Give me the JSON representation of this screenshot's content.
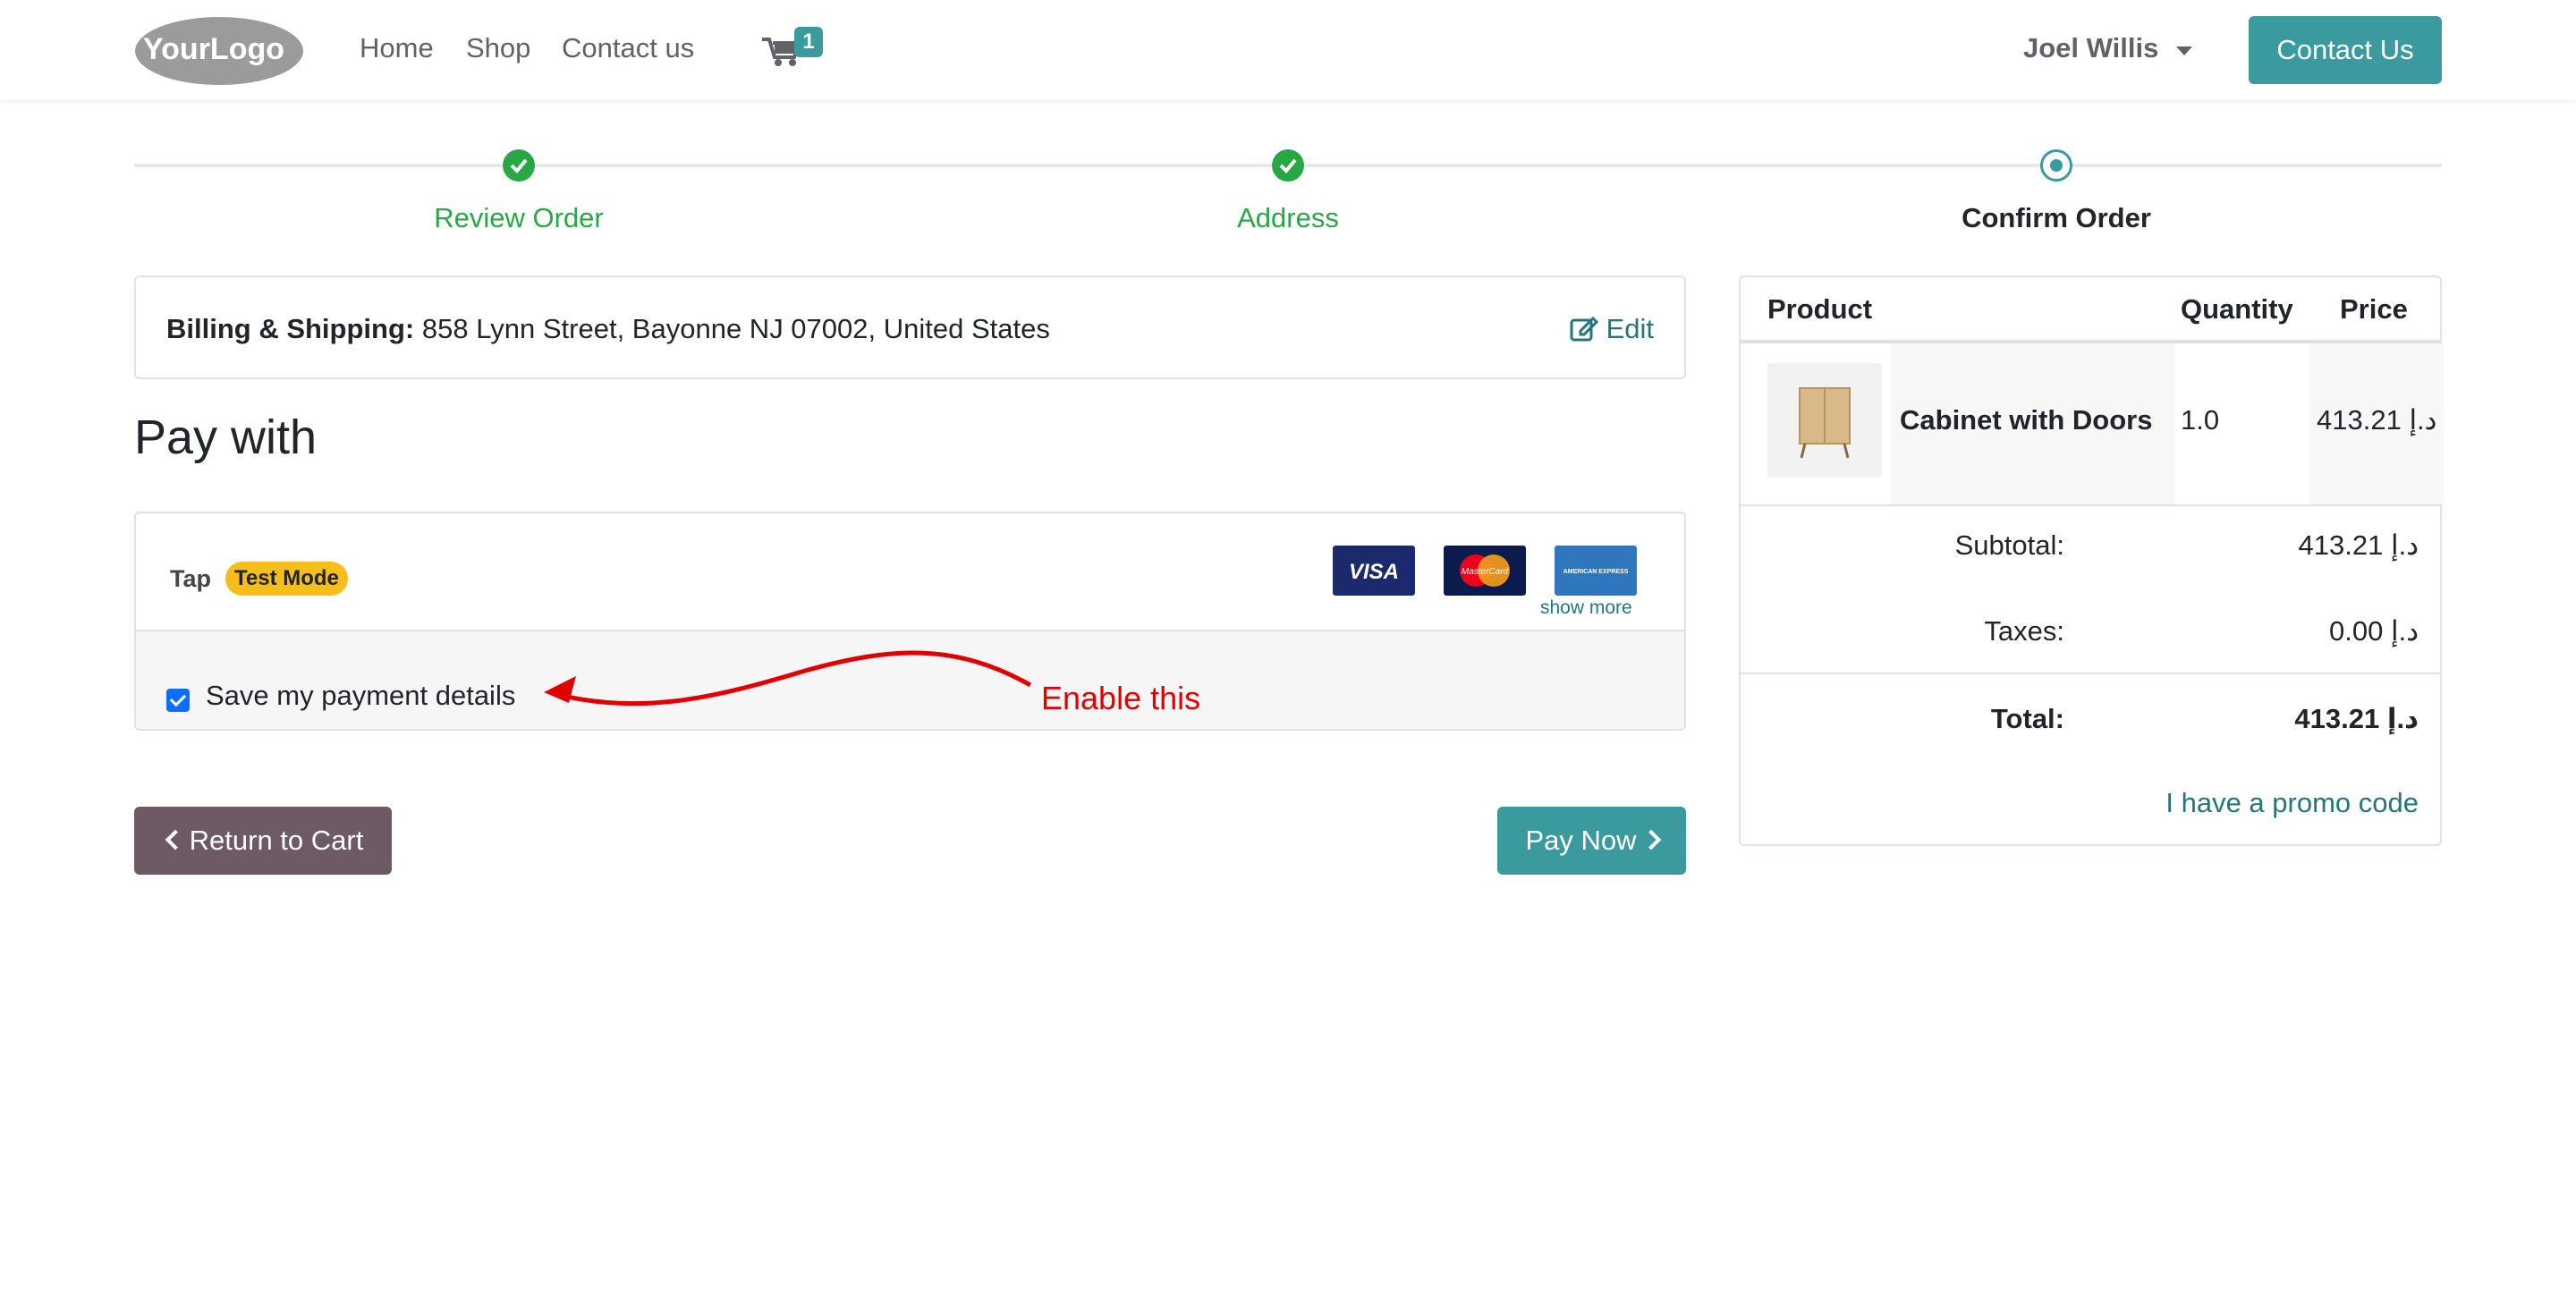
{
  "header": {
    "logo_text": "YourLogo",
    "nav": [
      "Home",
      "Shop",
      "Contact us"
    ],
    "cart_count": "1",
    "user_name": "Joel Willis",
    "contact_button": "Contact Us"
  },
  "wizard": {
    "steps": [
      {
        "label": "Review Order",
        "state": "done"
      },
      {
        "label": "Address",
        "state": "done"
      },
      {
        "label": "Confirm Order",
        "state": "current"
      }
    ]
  },
  "billing": {
    "label": "Billing & Shipping:",
    "address": "858 Lynn Street, Bayonne NJ 07002, United States",
    "edit_label": "Edit"
  },
  "payment": {
    "title": "Pay with",
    "provider": "Tap",
    "badge": "Test Mode",
    "cards": [
      "VISA",
      "MasterCard",
      "AMERICAN EXPRESS"
    ],
    "show_more": "show more",
    "save_label": "Save my payment details",
    "save_checked": true,
    "annotation": "Enable this"
  },
  "buttons": {
    "return": "Return to Cart",
    "pay_now": "Pay Now"
  },
  "summary": {
    "headers": {
      "product": "Product",
      "quantity": "Quantity",
      "price": "Price"
    },
    "items": [
      {
        "name": "Cabinet with Doors",
        "quantity": "1.0",
        "price": "413.21 د.إ"
      }
    ],
    "subtotal_label": "Subtotal:",
    "subtotal": "413.21 د.إ",
    "taxes_label": "Taxes:",
    "taxes": "0.00 د.إ",
    "total_label": "Total:",
    "total": "413.21 د.إ",
    "promo": "I have a promo code"
  },
  "colors": {
    "accent": "#3a9a9e",
    "success": "#28a745",
    "secondary": "#6d5a64",
    "warning": "#f5be1b",
    "annotation": "#e00000"
  }
}
